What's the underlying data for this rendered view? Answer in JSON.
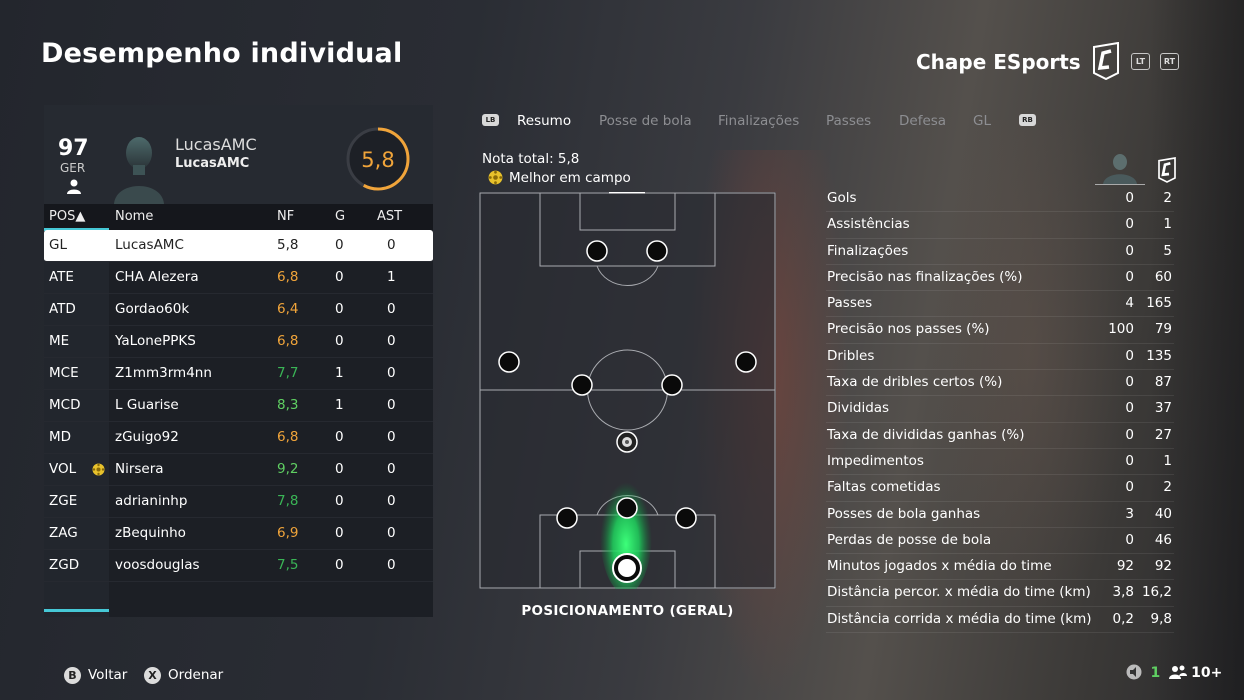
{
  "header": {
    "title": "Desempenho individual",
    "team": "Chape ESports",
    "btn_lt": "LT",
    "btn_rt": "RT"
  },
  "player": {
    "overall": "97",
    "position": "GER",
    "name": "LucasAMC",
    "subname": "LucasAMC",
    "match_rating": "5,8"
  },
  "table": {
    "headers": {
      "pos": "POS▲",
      "name": "Nome",
      "nf": "NF",
      "g": "G",
      "ast": "AST"
    },
    "rows": [
      {
        "pos": "GL",
        "name": "LucasAMC",
        "nf": "5,8",
        "g": "0",
        "ast": "0"
      },
      {
        "pos": "ATE",
        "name": "CHA Alezera",
        "nf": "6,8",
        "g": "0",
        "ast": "1"
      },
      {
        "pos": "ATD",
        "name": "Gordao60k",
        "nf": "6,4",
        "g": "0",
        "ast": "0"
      },
      {
        "pos": "ME",
        "name": "YaLonePPKS",
        "nf": "6,8",
        "g": "0",
        "ast": "0"
      },
      {
        "pos": "MCE",
        "name": "Z1mm3rm4nn",
        "nf": "7,7",
        "g": "1",
        "ast": "0"
      },
      {
        "pos": "MCD",
        "name": "L Guarise",
        "nf": "8,3",
        "g": "1",
        "ast": "0"
      },
      {
        "pos": "MD",
        "name": "zGuigo92",
        "nf": "6,8",
        "g": "0",
        "ast": "0"
      },
      {
        "pos": "VOL",
        "name": "Nirsera",
        "nf": "9,2",
        "g": "0",
        "ast": "0"
      },
      {
        "pos": "ZGE",
        "name": "adrianinhp",
        "nf": "7,8",
        "g": "0",
        "ast": "0"
      },
      {
        "pos": "ZAG",
        "name": "zBequinho",
        "nf": "6,9",
        "g": "0",
        "ast": "0"
      },
      {
        "pos": "ZGD",
        "name": "voosdouglas",
        "nf": "7,5",
        "g": "0",
        "ast": "0"
      }
    ]
  },
  "tabs": {
    "lb": "LB",
    "rb": "RB",
    "items": [
      "Resumo",
      "Posse de bola",
      "Finalizações",
      "Passes",
      "Defesa",
      "GL"
    ]
  },
  "summary": {
    "nota_total": "Nota total: 5,8",
    "best": "Melhor em campo",
    "pitch_caption": "POSICIONAMENTO (GERAL)"
  },
  "stats": [
    {
      "label": "Gols",
      "player": "0",
      "team": "2"
    },
    {
      "label": "Assistências",
      "player": "0",
      "team": "1"
    },
    {
      "label": "Finalizações",
      "player": "0",
      "team": "5"
    },
    {
      "label": "Precisão nas finalizações (%)",
      "player": "0",
      "team": "60"
    },
    {
      "label": "Passes",
      "player": "4",
      "team": "165"
    },
    {
      "label": "Precisão nos passes (%)",
      "player": "100",
      "team": "79"
    },
    {
      "label": "Dribles",
      "player": "0",
      "team": "135"
    },
    {
      "label": "Taxa de dribles certos (%)",
      "player": "0",
      "team": "87"
    },
    {
      "label": "Divididas",
      "player": "0",
      "team": "37"
    },
    {
      "label": "Taxa de divididas ganhas (%)",
      "player": "0",
      "team": "27"
    },
    {
      "label": "Impedimentos",
      "player": "0",
      "team": "1"
    },
    {
      "label": "Faltas cometidas",
      "player": "0",
      "team": "2"
    },
    {
      "label": "Posses de bola ganhas",
      "player": "3",
      "team": "40"
    },
    {
      "label": "Perdas de posse de bola",
      "player": "0",
      "team": "46"
    },
    {
      "label": "Minutos jogados x média do time",
      "player": "92",
      "team": "92"
    },
    {
      "label": "Distância percor. x média do time (km)",
      "player": "3,8",
      "team": "16,2"
    },
    {
      "label": "Distância corrida x média do time (km)",
      "player": "0,2",
      "team": "9,8"
    }
  ],
  "footer": {
    "back_btn": "B",
    "back": "Voltar",
    "sort_btn": "X",
    "sort": "Ordenar",
    "count": "1",
    "players": "10+"
  },
  "colors": {
    "accent_teal": "#46c8d6",
    "rating_orange": "#f0a43a",
    "rating_green": "#5fcf62"
  }
}
